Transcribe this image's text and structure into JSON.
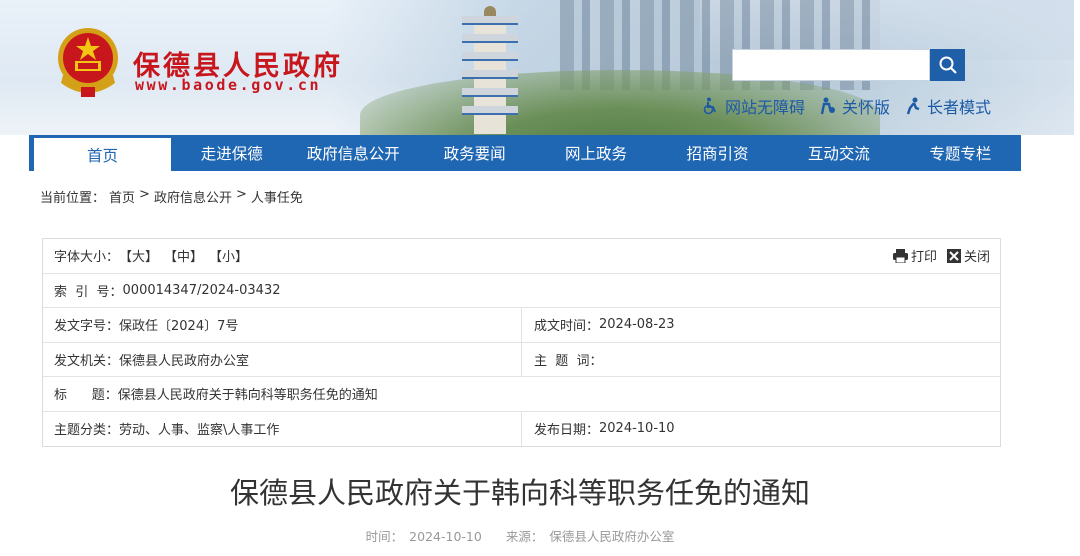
{
  "header": {
    "title": "保德县人民政府",
    "url": "www.baode.gov.cn",
    "search_placeholder": "",
    "tools": [
      {
        "label": "网站无障碍",
        "icon": "wheelchair-icon"
      },
      {
        "label": "关怀版",
        "icon": "care-icon"
      },
      {
        "label": "长者模式",
        "icon": "elder-icon"
      }
    ]
  },
  "nav": {
    "items": [
      "首页",
      "走进保德",
      "政府信息公开",
      "政务要闻",
      "网上政务",
      "招商引资",
      "互动交流",
      "专题专栏"
    ],
    "active": "首页"
  },
  "breadcrumb": {
    "prefix": "当前位置：",
    "items": [
      "首页",
      "政府信息公开",
      "人事任免"
    ],
    "sep": ">"
  },
  "meta": {
    "font_size_label": "字体大小：",
    "font_sizes": [
      "【大】",
      "【中】",
      "【小】"
    ],
    "print": "打印",
    "close": "关闭",
    "index_label": "索  引  号：",
    "index_value": "000014347/2024-03432",
    "doc_no_label": "发文字号：",
    "doc_no_value": "保政任〔2024〕7号",
    "created_label": "成文时间：",
    "created_value": "2024-08-23",
    "issuer_label": "发文机关：",
    "issuer_value": "保德县人民政府办公室",
    "subject_label": "主  题  词：",
    "subject_value": "",
    "title_label": "标      题：",
    "title_value": "保德县人民政府关于韩向科等职务任免的通知",
    "category_label": "主题分类：",
    "category_value": "劳动、人事、监察\\人事工作",
    "published_label": "发布日期：",
    "published_value": "2024-10-10"
  },
  "article": {
    "title": "保德县人民政府关于韩向科等职务任免的通知",
    "time_label": "时间：",
    "time_value": "2024-10-10",
    "source_label": "来源：",
    "source_value": "保德县人民政府办公室"
  },
  "colors": {
    "brand_red": "#c8161d",
    "nav_blue": "#1f66b3"
  }
}
